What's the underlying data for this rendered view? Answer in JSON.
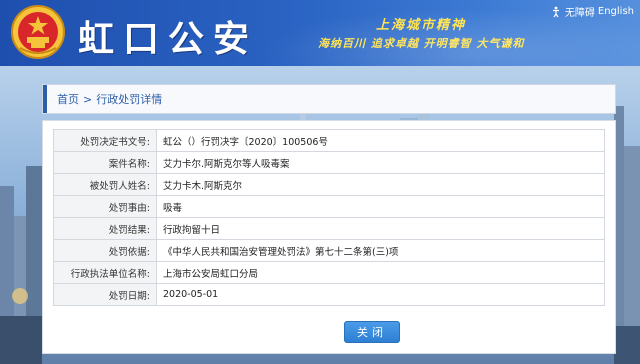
{
  "header": {
    "site_name": "虹口公安",
    "spirit_title": "上海城市精神",
    "spirit_slogan": "海纳百川 追求卓越 开明睿智 大气谦和",
    "accessibility_label": "无障碍",
    "language_link": "English"
  },
  "breadcrumb": {
    "home": "首页",
    "separator": ">",
    "current": "行政处罚详情"
  },
  "details": [
    {
      "label": "处罚决定书文号:",
      "value": "虹公（）行罚决字〔2020〕100506号"
    },
    {
      "label": "案件名称:",
      "value": "艾力卡尔.阿斯克尔等人吸毒案"
    },
    {
      "label": "被处罚人姓名:",
      "value": "艾力卡木.阿斯克尔"
    },
    {
      "label": "处罚事由:",
      "value": "吸毒"
    },
    {
      "label": "处罚结果:",
      "value": "行政拘留十日"
    },
    {
      "label": "处罚依据:",
      "value": "《中华人民共和国治安管理处罚法》第七十二条第(三)项"
    },
    {
      "label": "行政执法单位名称:",
      "value": "上海市公安局虹口分局"
    },
    {
      "label": "处罚日期:",
      "value": "2020-05-01"
    }
  ],
  "buttons": {
    "close_label": "关闭"
  },
  "colors": {
    "header_blue": "#2a63c3",
    "accent_blue": "#2c5fa8",
    "slogan_yellow": "#ffe24a",
    "button_blue": "#2f7fd4"
  }
}
